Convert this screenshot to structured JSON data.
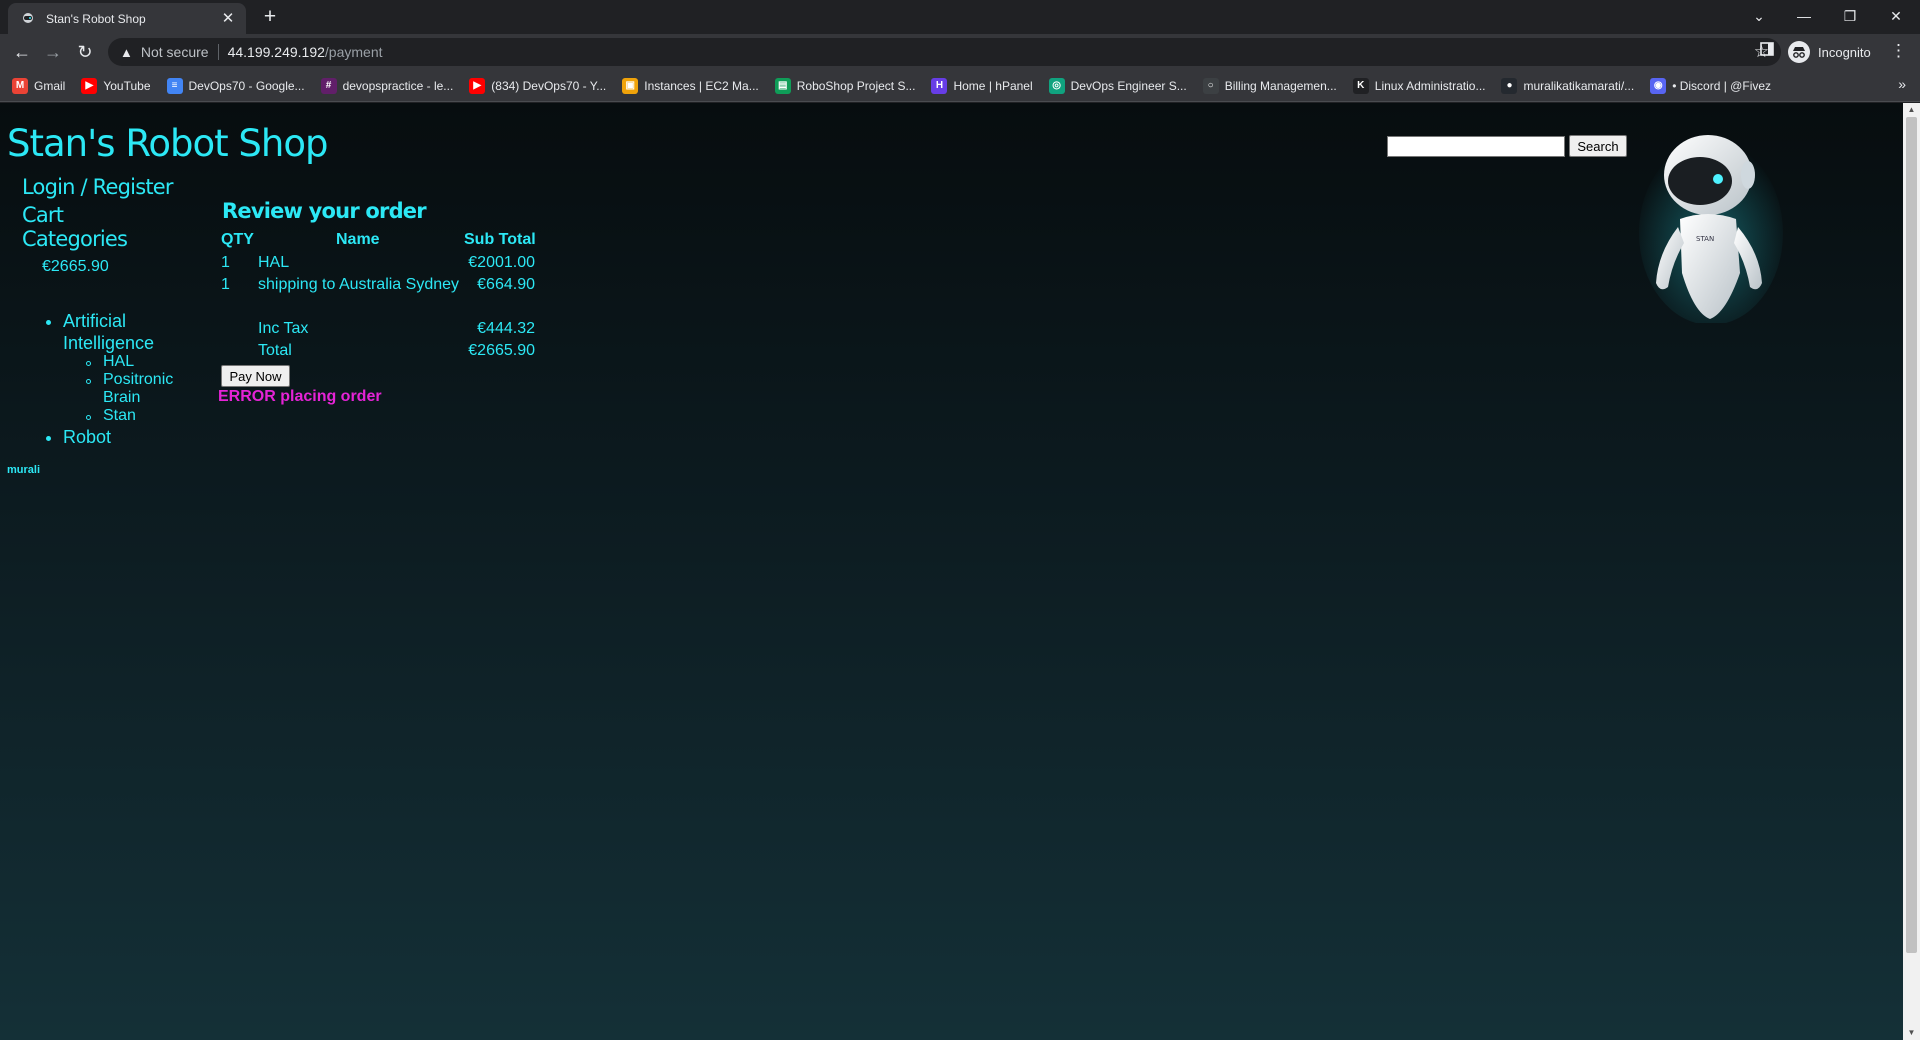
{
  "browser": {
    "tab_title": "Stan's Robot Shop",
    "not_secure": "Not secure",
    "url_host": "44.199.249.192",
    "url_path": "/payment",
    "profile_label": "Incognito",
    "bookmarks": [
      {
        "label": "Gmail",
        "icon": "gmail-icon",
        "color": "#ea4335",
        "glyph": "M"
      },
      {
        "label": "YouTube",
        "icon": "youtube-icon",
        "color": "#ff0000",
        "glyph": "▶"
      },
      {
        "label": "DevOps70 - Google...",
        "icon": "google-docs-icon",
        "color": "#4285f4",
        "glyph": "≡"
      },
      {
        "label": "devopspractice - le...",
        "icon": "slack-icon",
        "color": "#611f69",
        "glyph": "#"
      },
      {
        "label": "(834) DevOps70 - Y...",
        "icon": "youtube-icon",
        "color": "#ff0000",
        "glyph": "▶"
      },
      {
        "label": "Instances | EC2 Ma...",
        "icon": "aws-icon",
        "color": "#f0a30a",
        "glyph": "▣"
      },
      {
        "label": "RoboShop Project S...",
        "icon": "google-sheets-icon",
        "color": "#0f9d58",
        "glyph": "▤"
      },
      {
        "label": "Home | hPanel",
        "icon": "hostinger-icon",
        "color": "#673de6",
        "glyph": "H"
      },
      {
        "label": "DevOps Engineer S...",
        "icon": "chatgpt-icon",
        "color": "#10a37f",
        "glyph": "◎"
      },
      {
        "label": "Billing Managemen...",
        "icon": "billing-icon",
        "color": "#3c4043",
        "glyph": "○"
      },
      {
        "label": "Linux Administratio...",
        "icon": "k-icon",
        "color": "#202124",
        "glyph": "K"
      },
      {
        "label": "muralikatikamarati/...",
        "icon": "github-icon",
        "color": "#24292f",
        "glyph": "●"
      },
      {
        "label": "• Discord | @Fivez",
        "icon": "discord-icon",
        "color": "#5865f2",
        "glyph": "◉"
      }
    ]
  },
  "site": {
    "title": "Stan's Robot Shop",
    "search_button": "Search",
    "search_value": "",
    "login_register": "Login / Register",
    "cart_label": "Cart",
    "cart_amount": "€2665.90",
    "categories_label": "Categories",
    "categories": {
      "ai": "Artificial Intelligence",
      "ai_items": [
        "HAL",
        "Positronic Brain",
        "Stan"
      ],
      "robot": "Robot"
    },
    "user": "murali",
    "robot_badge": "STAN"
  },
  "order": {
    "heading": "Review your order",
    "headers": {
      "qty": "QTY",
      "name": "Name",
      "subtotal": "Sub Total"
    },
    "rows": [
      {
        "qty": "1",
        "name": "HAL",
        "subtotal": "€2001.00"
      },
      {
        "qty": "1",
        "name": "shipping to Australia Sydney",
        "subtotal": "€664.90"
      }
    ],
    "tax_label": "Inc Tax",
    "tax_value": "€444.32",
    "total_label": "Total",
    "total_value": "€2665.90",
    "pay_button": "Pay Now",
    "error": "ERROR placing order"
  },
  "colors": {
    "accent": "#2ce8f5",
    "error": "#e523d6"
  }
}
